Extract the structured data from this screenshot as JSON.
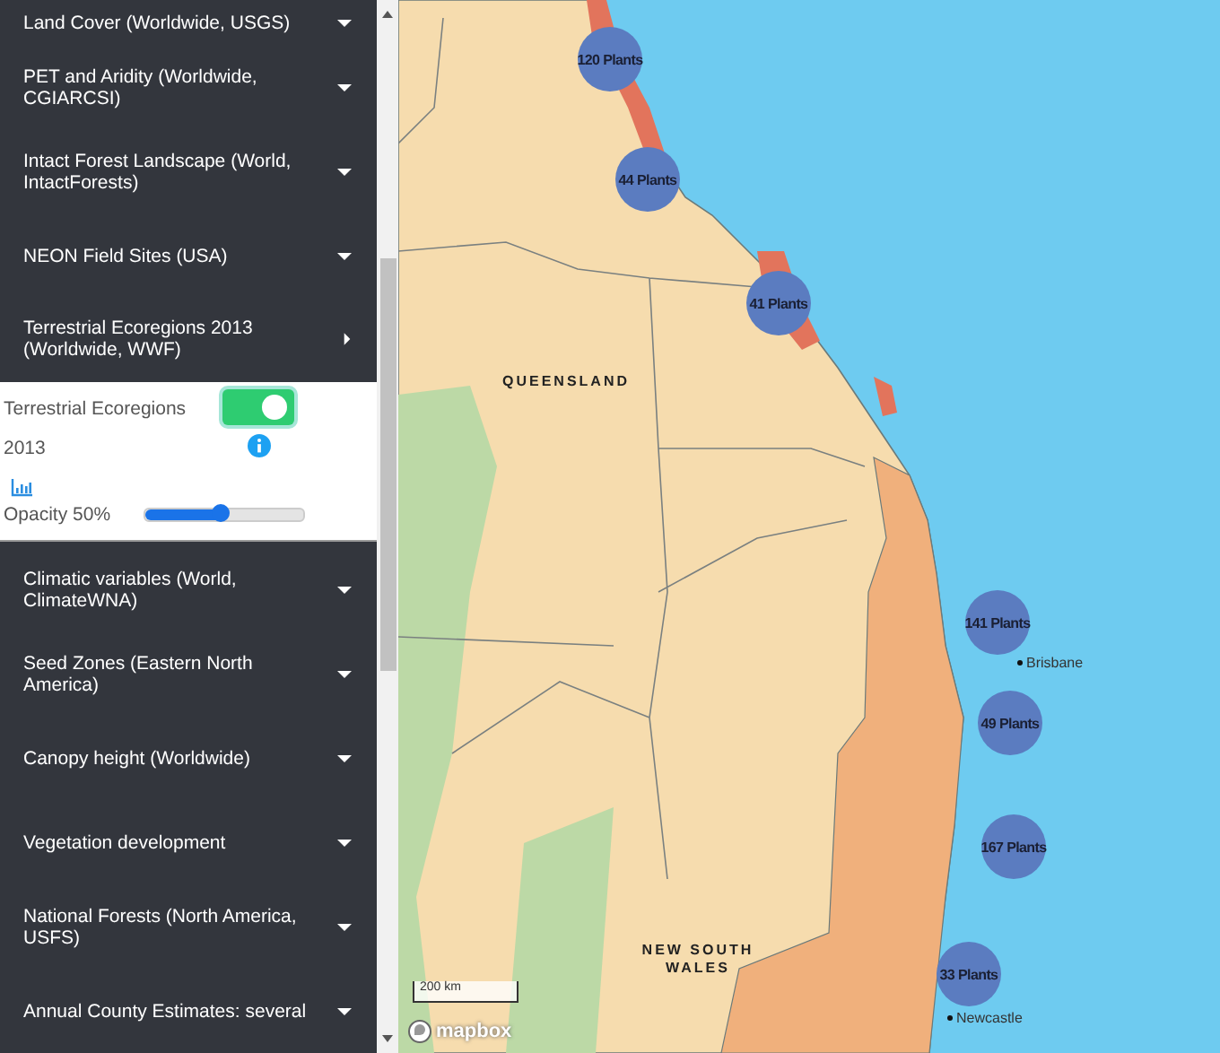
{
  "sidebar": {
    "layers": [
      {
        "label": "Land Cover (Worldwide, USGS)",
        "expanded": false
      },
      {
        "label": "PET and Aridity (Worldwide, CGIARCSI)",
        "expanded": false
      },
      {
        "label": "Intact Forest Landscape (World, IntactForests)",
        "expanded": false
      },
      {
        "label": "NEON Field Sites (USA)",
        "expanded": false
      },
      {
        "label": "Terrestrial Ecoregions 2013 (Worldwide, WWF)",
        "expanded": true,
        "panel": {
          "name": "Terrestrial Ecoregions 2013",
          "on": true,
          "opacity_label": "Opacity 50%",
          "level": 0.48
        }
      },
      {
        "label": "Climatic variables (World, ClimateWNA)",
        "expanded": false
      },
      {
        "label": "Seed Zones (Eastern North America)",
        "expanded": false
      },
      {
        "label": "Canopy height (Worldwide)",
        "expanded": false
      },
      {
        "label": "Vegetation development",
        "expanded": false
      },
      {
        "label": "National Forests (North America, USFS)",
        "expanded": false
      },
      {
        "label": "Annual County Estimates: several",
        "expanded": false
      }
    ]
  },
  "map": {
    "markers": [
      {
        "label": "120 Plants"
      },
      {
        "label": "44 Plants"
      },
      {
        "label": "41 Plants"
      },
      {
        "label": "141 Plants"
      },
      {
        "label": "49 Plants"
      },
      {
        "label": "167 Plants"
      },
      {
        "label": "33 Plants"
      }
    ],
    "regions": [
      {
        "label": "QUEENSLAND"
      },
      {
        "label": "NEW SOUTH WALES"
      }
    ],
    "cities": [
      {
        "label": "Brisbane"
      },
      {
        "label": "Newcastle"
      }
    ],
    "scale": "200 km",
    "logo": "mapbox"
  }
}
